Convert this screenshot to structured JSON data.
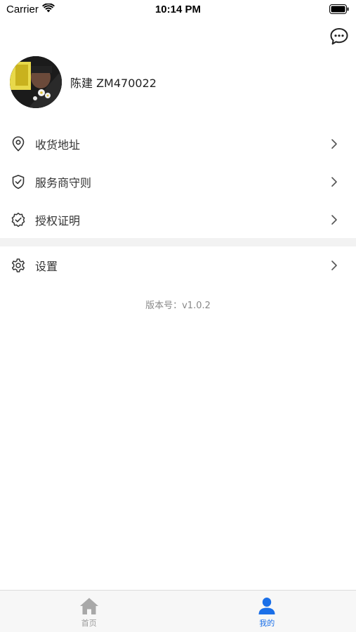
{
  "status_bar": {
    "carrier": "Carrier",
    "time": "10:14 PM"
  },
  "profile": {
    "name": "陈建 ZM470022"
  },
  "menu": {
    "group1": [
      {
        "label": "收货地址",
        "icon": "location-pin-icon"
      },
      {
        "label": "服务商守则",
        "icon": "shield-check-icon"
      },
      {
        "label": "授权证明",
        "icon": "certificate-badge-icon"
      }
    ],
    "group2": [
      {
        "label": "设置",
        "icon": "gear-icon"
      }
    ]
  },
  "version": "版本号：v1.0.2",
  "tab_bar": {
    "tabs": [
      {
        "label": "首页",
        "icon": "home-icon",
        "active": false
      },
      {
        "label": "我的",
        "icon": "user-icon",
        "active": true
      }
    ]
  },
  "colors": {
    "accent": "#1a6fe8",
    "inactive": "#9a9a9a",
    "separator_band": "#f2f2f2"
  }
}
